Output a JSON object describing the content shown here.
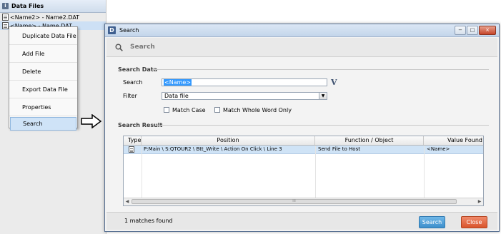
{
  "data_files": {
    "title": "Data Files",
    "files": [
      "<Name2> - Name2.DAT",
      "<Name> - Name.DAT"
    ]
  },
  "context_menu": {
    "items": [
      "Duplicate Data File",
      "Add File",
      "Delete",
      "Export Data File",
      "Properties",
      "Search"
    ]
  },
  "dialog": {
    "app_icon": "D",
    "title": "Search",
    "window_buttons": {
      "minimize": "−",
      "maximize": "□",
      "close": "×"
    },
    "search_header": "Search",
    "search_data_label": "Search Data",
    "search_label": "Search",
    "search_value": "<Name>",
    "v_button": "V",
    "filter_label": "Filter",
    "filter_value": "Data file",
    "match_case": "Match Case",
    "match_whole_word": "Match Whole Word Only",
    "search_result_label": "Search Result",
    "columns": [
      "Type",
      "Position",
      "Function / Object",
      "Value Found"
    ],
    "rows": [
      {
        "position": "P:Main \\ S:QTOUR2 \\ Btt_Write \\ Action On Click \\  Line 3",
        "function": "Send File to Host",
        "value": "<Name>"
      }
    ],
    "scroll_left": "◀",
    "scroll_right": "▶",
    "scroll_grip": "III",
    "matches_found": "1 matches found",
    "search_button": "Search",
    "close_button": "Close"
  },
  "colors": {
    "accent_blue": "#3d8fcb",
    "close_orange": "#d9542c",
    "selection": "#cfe3f6"
  }
}
